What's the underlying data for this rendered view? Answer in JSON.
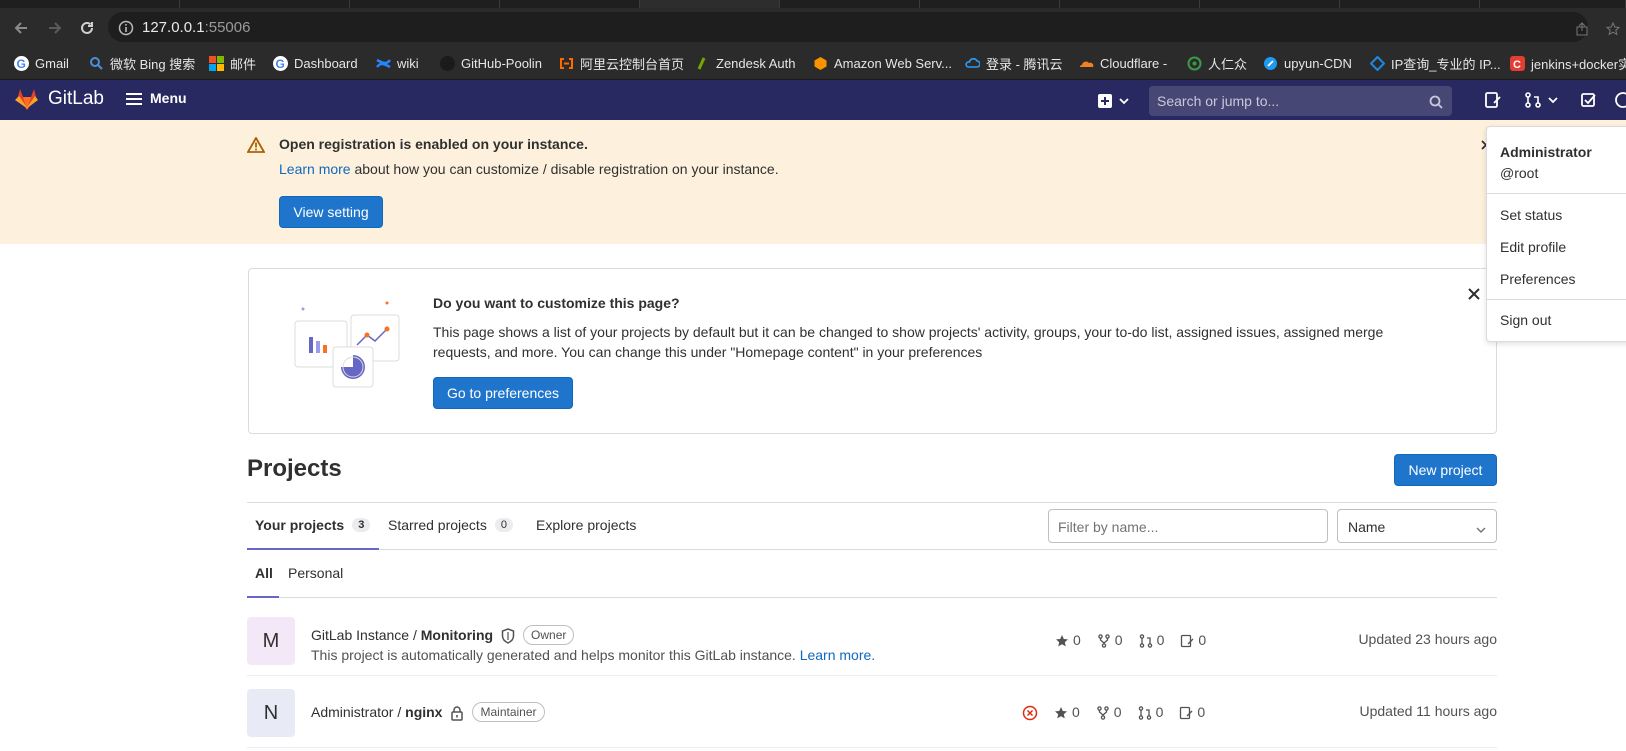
{
  "browser": {
    "url_host": "127.0.0.1",
    "url_port": ":55006",
    "bookmarks": [
      {
        "label": "Gmail",
        "icon": "google-icon",
        "color": "#4285f4"
      },
      {
        "label": "微软 Bing 搜索",
        "icon": "bing-search-icon",
        "color": "#4a90d9"
      },
      {
        "label": "邮件",
        "icon": "microsoft-icon",
        "color": "#f25022"
      },
      {
        "label": "Dashboard",
        "icon": "google-icon",
        "color": "#4285f4"
      },
      {
        "label": "wiki",
        "icon": "confluence-icon",
        "color": "#2684ff"
      },
      {
        "label": "GitHub-Poolin",
        "icon": "github-icon",
        "color": "#333333"
      },
      {
        "label": "阿里云控制台首页",
        "icon": "aliyun-icon",
        "color": "#ff6a00"
      },
      {
        "label": "Zendesk Auth",
        "icon": "zendesk-icon",
        "color": "#78a300"
      },
      {
        "label": "Amazon Web Serv...",
        "icon": "aws-icon",
        "color": "#f79400"
      },
      {
        "label": "登录 - 腾讯云",
        "icon": "tencent-cloud-icon",
        "color": "#2b9df7"
      },
      {
        "label": "Cloudflare -",
        "icon": "cloudflare-icon",
        "color": "#f38020"
      },
      {
        "label": "人仁众",
        "icon": "renrenzhong-icon",
        "color": "#3c9a4c"
      },
      {
        "label": "upyun-CDN",
        "icon": "upyun-icon",
        "color": "#1e9bf0"
      },
      {
        "label": "IP查询_专业的 IP...",
        "icon": "ip-query-icon",
        "color": "#1e88e5"
      },
      {
        "label": "jenkins+docker实",
        "icon": "csdn-icon",
        "color": "#e33e33"
      }
    ]
  },
  "navbar": {
    "brand": "GitLab",
    "menu_label": "Menu",
    "search_placeholder": "Search or jump to...",
    "bg_color": "#292961"
  },
  "banner": {
    "title": "Open registration is enabled on your instance.",
    "learn_more": "Learn more",
    "body_rest": " about how you can customize / disable registration on your instance.",
    "button": "View setting"
  },
  "user_menu": {
    "name": "Administrator",
    "username": "@root",
    "items": [
      "Set status",
      "Edit profile",
      "Preferences"
    ],
    "sign_out": "Sign out"
  },
  "customize": {
    "title": "Do you want to customize this page?",
    "body": "This page shows a list of your projects by default but it can be changed to show projects' activity, groups, your to-do list, assigned issues, assigned merge requests, and more. You can change this under \"Homepage content\" in your preferences",
    "button": "Go to preferences"
  },
  "projects": {
    "title": "Projects",
    "new_button": "New project",
    "tabs": [
      {
        "label": "Your projects",
        "count": "3"
      },
      {
        "label": "Starred projects",
        "count": "0"
      },
      {
        "label": "Explore projects"
      }
    ],
    "filter_placeholder": "Filter by name...",
    "sort_value": "Name",
    "subtabs": [
      "All",
      "Personal"
    ],
    "rows": [
      {
        "avatar": "M",
        "avatar_bg": "#f4e7f7",
        "namespace": "GitLab Instance / ",
        "name": "Monitoring",
        "role": "Owner",
        "description": "This project is automatically generated and helps monitor this GitLab instance. ",
        "desc_link": "Learn more.",
        "stars": "0",
        "forks": "0",
        "mrs": "0",
        "issues": "0",
        "updated": "Updated 23 hours ago"
      },
      {
        "avatar": "N",
        "avatar_bg": "#e8eaf6",
        "namespace": "Administrator / ",
        "name": "nginx",
        "role": "Maintainer",
        "stars": "0",
        "forks": "0",
        "mrs": "0",
        "issues": "0",
        "updated": "Updated 11 hours ago",
        "pipeline": "failed"
      }
    ]
  }
}
